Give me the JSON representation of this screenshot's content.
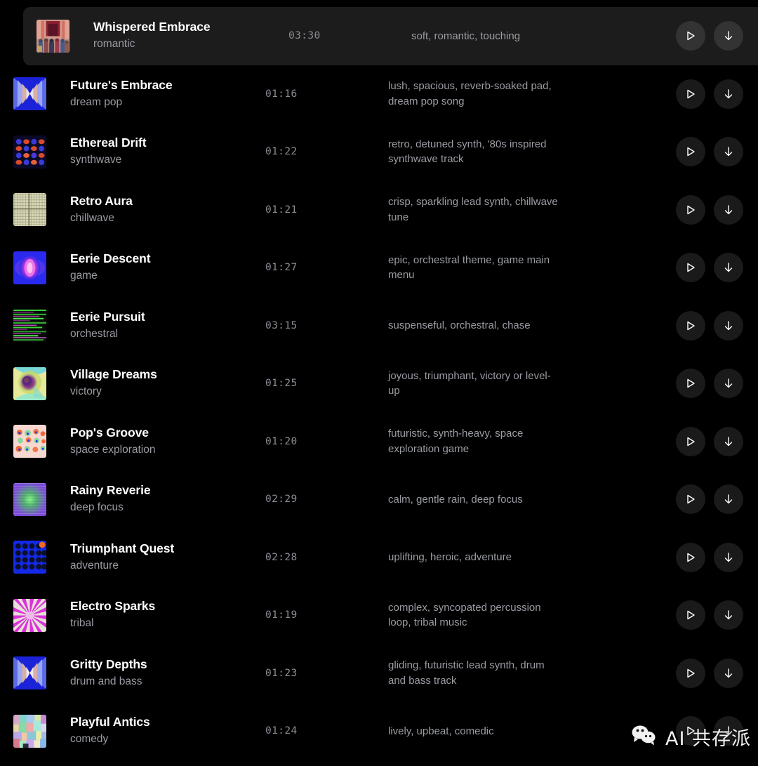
{
  "app": {
    "background_color": "#000000",
    "active_row_color": "#1c1c1c",
    "title_color": "#ffffff",
    "secondary_text_color": "#9a9ca3"
  },
  "watermark": {
    "icon": "wechat-icon",
    "text": "AI 共存派"
  },
  "actions": {
    "play_label": "play-icon",
    "download_label": "download-icon"
  },
  "tracks": [
    {
      "title": "Whispered Embrace",
      "genre": "romantic",
      "duration": "03:30",
      "tags": "soft, romantic, touching",
      "active": true,
      "art": "crowd-scene"
    },
    {
      "title": "Future's Embrace",
      "genre": "dream pop",
      "duration": "01:16",
      "tags": "lush, spacious, reverb-soaked pad, dream pop song",
      "active": false,
      "art": "blue-star"
    },
    {
      "title": "Ethereal Drift",
      "genre": "synthwave",
      "duration": "01:22",
      "tags": "retro, detuned synth, '80s inspired synthwave track",
      "active": false,
      "art": "dot-grid-red-blue"
    },
    {
      "title": "Retro Aura",
      "genre": "chillwave",
      "duration": "01:21",
      "tags": "crisp, sparkling lead synth, chillwave tune",
      "active": false,
      "art": "beige-weave"
    },
    {
      "title": "Eerie Descent",
      "genre": "game",
      "duration": "01:27",
      "tags": "epic, orchestral theme, game main menu",
      "active": false,
      "art": "magenta-bloom"
    },
    {
      "title": "Eerie Pursuit",
      "genre": "orchestral",
      "duration": "03:15",
      "tags": "suspenseful, orchestral, chase",
      "active": false,
      "art": "green-stripes"
    },
    {
      "title": "Village Dreams",
      "genre": "victory",
      "duration": "01:25",
      "tags": "joyous, triumphant, victory or level-up",
      "active": false,
      "art": "swirl-pastel"
    },
    {
      "title": "Pop's Groove",
      "genre": "space exploration",
      "duration": "01:20",
      "tags": "futuristic, synth-heavy, space exploration game",
      "active": false,
      "art": "pink-bubbles"
    },
    {
      "title": "Rainy Reverie",
      "genre": "deep focus",
      "duration": "02:29",
      "tags": "calm, gentle rain, deep focus",
      "active": false,
      "art": "green-purple-glow"
    },
    {
      "title": "Triumphant Quest",
      "genre": "adventure",
      "duration": "02:28",
      "tags": "uplifting, heroic, adventure",
      "active": false,
      "art": "blue-dots-orange"
    },
    {
      "title": "Electro Sparks",
      "genre": "tribal",
      "duration": "01:19",
      "tags": "complex, syncopated percussion loop, tribal music",
      "active": false,
      "art": "magenta-rays"
    },
    {
      "title": "Gritty Depths",
      "genre": "drum and bass",
      "duration": "01:23",
      "tags": "gliding, futuristic lead synth, drum and bass track",
      "active": false,
      "art": "blue-star-2"
    },
    {
      "title": "Playful Antics",
      "genre": "comedy",
      "duration": "01:24",
      "tags": "lively, upbeat, comedic",
      "active": false,
      "art": "pastel-mosaic"
    }
  ]
}
